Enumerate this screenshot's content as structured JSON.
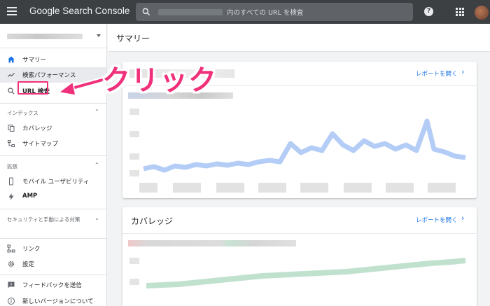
{
  "topbar": {
    "brand": "Google Search Console",
    "search_placeholder": "内のすべての URL を検査"
  },
  "sidebar": {
    "items_top": [
      {
        "label": "サマリー",
        "icon": "home-icon"
      },
      {
        "label": "検索パフォーマンス",
        "icon": "trending-up-icon"
      },
      {
        "label": "URL 検査",
        "icon": "search-icon"
      }
    ],
    "index_section": {
      "label": "インデックス",
      "items": [
        {
          "label": "カバレッジ",
          "icon": "file-copy-icon"
        },
        {
          "label": "サイトマップ",
          "icon": "sitemap-icon"
        }
      ]
    },
    "enhancements_section": {
      "label": "拡張",
      "items": [
        {
          "label": "モバイル ユーザビリティ",
          "icon": "smartphone-icon"
        },
        {
          "label": "AMP",
          "icon": "bolt-icon"
        }
      ]
    },
    "security_section": {
      "label": "セキュリティと手動による対策"
    },
    "items_bottom": [
      {
        "label": "リンク",
        "icon": "link-icon"
      },
      {
        "label": "設定",
        "icon": "gear-icon"
      },
      {
        "label": "フィードバックを送信",
        "icon": "feedback-icon"
      },
      {
        "label": "新しいバージョンについて",
        "icon": "info-icon"
      }
    ]
  },
  "main": {
    "title": "サマリー",
    "performance_card": {
      "link": "レポートを開く"
    },
    "coverage_card": {
      "title": "カバレッジ",
      "link": "レポートを開く"
    }
  },
  "annotation": {
    "text": "クリック",
    "color": "#f0307a"
  },
  "colors": {
    "topbar": "#3c4043",
    "accent_link": "#1a73e8",
    "highlight": "#f0307a",
    "perf_line": "#a7c4f5",
    "coverage_line": "#b6dcc7"
  }
}
